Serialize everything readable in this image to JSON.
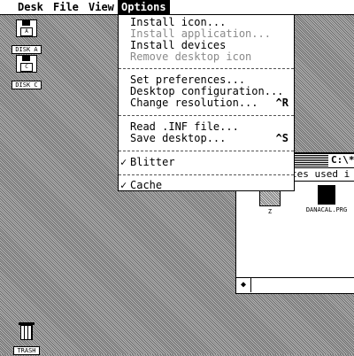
{
  "menubar": {
    "items": [
      {
        "label": "Desk"
      },
      {
        "label": "File"
      },
      {
        "label": "View"
      },
      {
        "label": "Options"
      }
    ]
  },
  "desktop": {
    "icons": [
      {
        "label": "DISK A",
        "tag": "A",
        "icon": "floppy-disk-icon"
      },
      {
        "label": "DISK C",
        "tag": "C",
        "icon": "floppy-disk-icon"
      }
    ],
    "trash": {
      "label": "TRASH",
      "icon": "trash-icon"
    }
  },
  "options_menu": {
    "items": [
      {
        "label": "Install icon...",
        "enabled": true,
        "shortcut": "",
        "checked": false
      },
      {
        "label": "Install application...",
        "enabled": false,
        "shortcut": "",
        "checked": false
      },
      {
        "label": "Install devices",
        "enabled": true,
        "shortcut": "",
        "checked": false
      },
      {
        "label": "Remove desktop icon",
        "enabled": false,
        "shortcut": "",
        "checked": false
      },
      {
        "label": "Set preferences...",
        "enabled": true,
        "shortcut": "",
        "checked": false
      },
      {
        "label": "Desktop configuration...",
        "enabled": true,
        "shortcut": "",
        "checked": false
      },
      {
        "label": "Change resolution...",
        "enabled": true,
        "shortcut": "^R",
        "checked": false
      },
      {
        "label": "Read .INF file...",
        "enabled": true,
        "shortcut": "",
        "checked": false
      },
      {
        "label": "Save desktop...",
        "enabled": true,
        "shortcut": "^S",
        "checked": false
      },
      {
        "label": "Blitter",
        "enabled": true,
        "shortcut": "",
        "checked": true
      },
      {
        "label": "Cache",
        "enabled": true,
        "shortcut": "",
        "checked": true
      }
    ],
    "check_mark": "✓"
  },
  "window": {
    "title": "C:\\*",
    "info": "tes used i",
    "files": [
      {
        "name": "Z",
        "type": "folder",
        "icon": "folder-icon"
      },
      {
        "name": "DANACAL.PRG",
        "type": "program",
        "icon": "program-icon"
      }
    ],
    "scroll_left_arrow": "◆"
  }
}
